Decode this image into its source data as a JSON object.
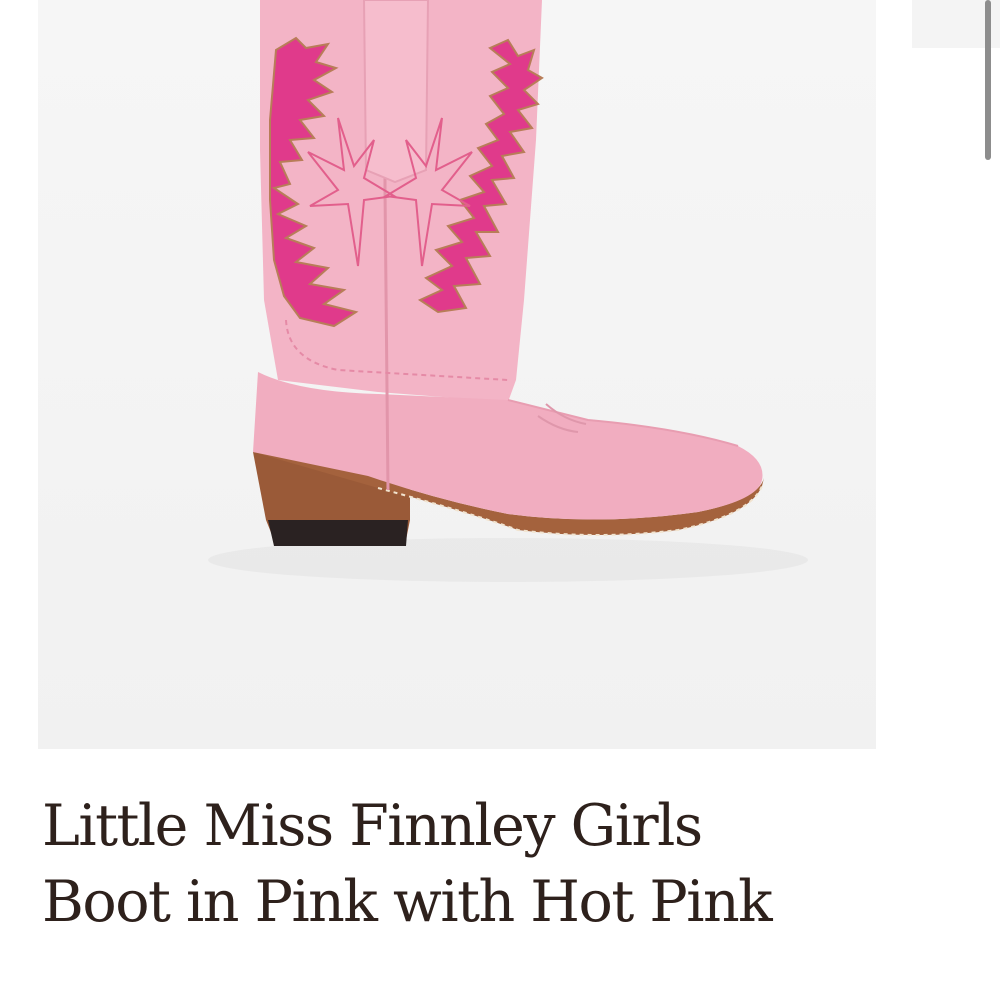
{
  "product": {
    "title": "Little Miss Finnley Girls Boot in Pink with Hot Pink",
    "image": {
      "subject": "boot-image",
      "colors": {
        "background": "#f4f4f4",
        "boot_pink": "#f3b3c4",
        "hot_pink": "#e0388a",
        "sole": "#a45f3a",
        "title_text": "#2e211c"
      }
    }
  },
  "gallery": {
    "next_thumbnail": "thumbnail-next"
  }
}
